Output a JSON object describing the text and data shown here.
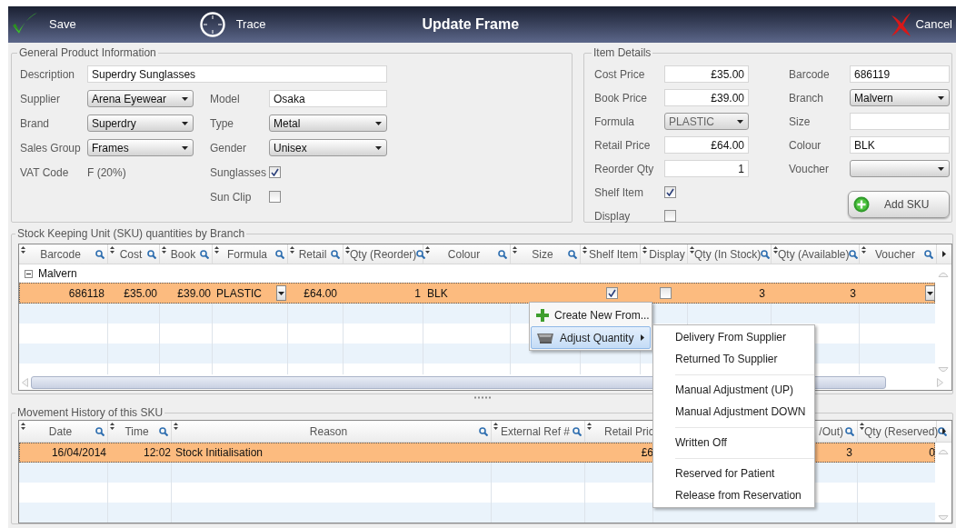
{
  "toolbar": {
    "save": "Save",
    "trace": "Trace",
    "title": "Update Frame",
    "cancel": "Cancel"
  },
  "general": {
    "legend": "General Product Information",
    "description": {
      "label": "Description",
      "kind": "text",
      "value": "Superdry Sunglasses"
    },
    "left": [
      {
        "label": "Supplier",
        "kind": "select",
        "value": "Arena Eyewear",
        "disabled": false
      },
      {
        "label": "Brand",
        "kind": "select",
        "value": "Superdry",
        "disabled": false
      },
      {
        "label": "Sales Group",
        "kind": "select",
        "value": "Frames",
        "disabled": false
      },
      {
        "label": "VAT Code",
        "kind": "static",
        "value": "F (20%)"
      }
    ],
    "right": [
      {
        "label": "Model",
        "kind": "text",
        "value": "Osaka"
      },
      {
        "label": "Type",
        "kind": "select",
        "value": "Metal",
        "disabled": false
      },
      {
        "label": "Gender",
        "kind": "select",
        "value": "Unisex",
        "disabled": false
      },
      {
        "label": "Sunglasses",
        "kind": "checkbox",
        "checked": true
      },
      {
        "label": "Sun Clip",
        "kind": "checkbox",
        "checked": false
      }
    ]
  },
  "item_details": {
    "legend": "Item Details",
    "left": [
      {
        "label": "Cost Price",
        "kind": "number",
        "value": "£35.00"
      },
      {
        "label": "Book Price",
        "kind": "number",
        "value": "£39.00"
      },
      {
        "label": "Formula",
        "kind": "select",
        "value": "PLASTIC",
        "disabled": true
      },
      {
        "label": "Retail Price",
        "kind": "number",
        "value": "£64.00"
      },
      {
        "label": "Reorder Qty",
        "kind": "number",
        "value": "1"
      },
      {
        "label": "Shelf Item",
        "kind": "checkbox",
        "checked": true
      },
      {
        "label": "Display",
        "kind": "checkbox",
        "checked": false
      }
    ],
    "right": [
      {
        "label": "Barcode",
        "kind": "text",
        "value": "686119"
      },
      {
        "label": "Branch",
        "kind": "select",
        "value": "Malvern",
        "disabled": false
      },
      {
        "label": "Size",
        "kind": "text"
      },
      {
        "label": "Colour",
        "kind": "text",
        "value": "BLK"
      },
      {
        "label": "Voucher",
        "kind": "select"
      }
    ],
    "add_button": "Add SKU"
  },
  "sku": {
    "legend": "Stock Keeping Unit (SKU) quantities by Branch",
    "columns": [
      {
        "label": "Barcode",
        "search": true,
        "kind": "number"
      },
      {
        "label": "Cost",
        "search": true,
        "kind": "number"
      },
      {
        "label": "Book",
        "search": true,
        "kind": "number"
      },
      {
        "label": "Formula",
        "search": true,
        "kind": "select"
      },
      {
        "label": "Retail",
        "search": true,
        "kind": "number"
      },
      {
        "label": "Qty (Reorder)",
        "search": true,
        "kind": "number"
      },
      {
        "label": "Colour",
        "search": true,
        "kind": "text"
      },
      {
        "label": "Size",
        "search": true,
        "kind": "text"
      },
      {
        "label": "Shelf Item",
        "search": false,
        "kind": "check"
      },
      {
        "label": "Display",
        "search": false,
        "kind": "check"
      },
      {
        "label": "Qty (In Stock)",
        "search": true,
        "kind": "number"
      },
      {
        "label": "Qty (Available)",
        "search": true,
        "kind": "number"
      },
      {
        "label": "Voucher",
        "search": true,
        "kind": "select"
      }
    ],
    "groups": [
      {
        "label": "Malvern",
        "expanded": true,
        "rows": [
          {
            "selected": true,
            "cells": [
              "686118",
              "£35.00",
              "£39.00",
              "PLASTIC",
              "£64.00",
              "1",
              "BLK",
              null,
              true,
              false,
              "3",
              "3",
              null
            ]
          }
        ]
      }
    ]
  },
  "movement": {
    "legend": "Movement History of this SKU",
    "columns": [
      {
        "label": "Date",
        "search": true,
        "kind": "number"
      },
      {
        "label": "Time",
        "search": true,
        "kind": "number"
      },
      {
        "label": "Reason",
        "search": true,
        "kind": "text"
      },
      {
        "label": "External Ref #",
        "search": true,
        "kind": "text"
      },
      {
        "label": "Retail Pric",
        "search": false,
        "kind": "number"
      },
      {
        "label": "/Out)",
        "search": true,
        "kind": "number"
      },
      {
        "label": "Qty (Reserved)",
        "search": true,
        "kind": "number"
      }
    ],
    "rows": [
      {
        "selected": true,
        "cells": [
          "16/04/2014",
          "12:02",
          "Stock Initialisation",
          null,
          "£6",
          "3",
          "0"
        ]
      }
    ]
  },
  "context_menu": {
    "items": [
      {
        "label": "Create New From...",
        "selected": false,
        "has_submenu": false
      },
      {
        "label": "Adjust Quantity",
        "selected": true,
        "has_submenu": true
      }
    ]
  },
  "submenu": {
    "items": [
      {
        "kind": "item",
        "label": "Delivery From Supplier",
        "selected": false
      },
      {
        "kind": "item",
        "label": "Returned To Supplier",
        "selected": false
      },
      {
        "kind": "separator"
      },
      {
        "kind": "item",
        "label": "Manual Adjustment (UP)",
        "selected": false
      },
      {
        "kind": "item",
        "label": "Manual Adjustment DOWN",
        "selected": false
      },
      {
        "kind": "separator"
      },
      {
        "kind": "item",
        "label": "Written Off",
        "selected": false
      },
      {
        "kind": "separator"
      },
      {
        "kind": "item",
        "label": "Reserved for Patient",
        "selected": false
      },
      {
        "kind": "item",
        "label": "Release from Reservation",
        "selected": false
      }
    ]
  }
}
